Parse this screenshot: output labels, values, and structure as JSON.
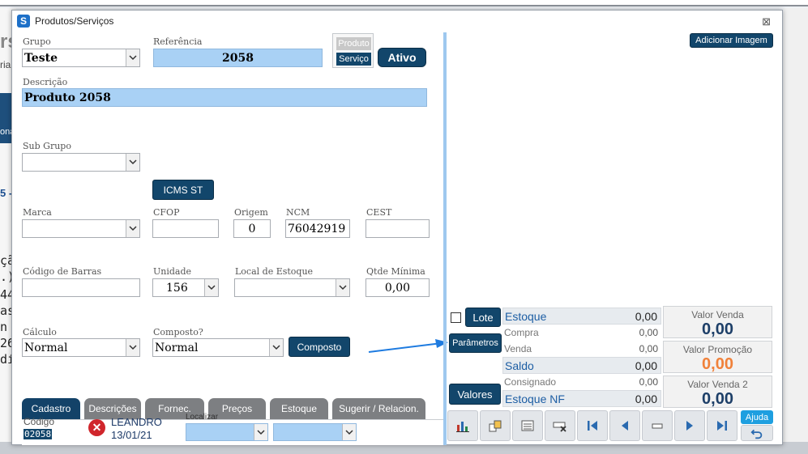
{
  "window": {
    "title": "Produtos/Serviços",
    "close_glyph": "⊠"
  },
  "background": {
    "code_lines": [
      "çã",
      ".)",
      "44",
      "as",
      "n t",
      "26",
      "dí"
    ],
    "side_texts": [
      "rs",
      "ria",
      "ona",
      "5 -"
    ]
  },
  "form": {
    "grupo": {
      "label": "Grupo",
      "value": "Teste"
    },
    "referencia": {
      "label": "Referência",
      "value": "2058"
    },
    "tipo": {
      "produto": "Produto",
      "servico": "Serviço"
    },
    "status_button": "Ativo",
    "descricao": {
      "label": "Descrição",
      "value": "Produto 2058"
    },
    "sub_grupo": {
      "label": "Sub Grupo",
      "value": ""
    },
    "icms_button": "ICMS ST",
    "marca": {
      "label": "Marca",
      "value": ""
    },
    "cfop": {
      "label": "CFOP",
      "value": ""
    },
    "origem": {
      "label": "Origem",
      "value": "0"
    },
    "ncm": {
      "label": "NCM",
      "value": "76042919"
    },
    "cest": {
      "label": "CEST",
      "value": ""
    },
    "codigo_barras": {
      "label": "Código de Barras",
      "value": ""
    },
    "unidade": {
      "label": "Unidade",
      "value": "156"
    },
    "local_estoque": {
      "label": "Local de Estoque",
      "value": ""
    },
    "qtde_minima": {
      "label": "Qtde Mínima",
      "value": "0,00"
    },
    "calculo": {
      "label": "Cálculo",
      "value": "Normal"
    },
    "composto": {
      "label": "Composto?",
      "value": "Normal"
    },
    "composto_button": "Composto"
  },
  "tabs": [
    "Cadastro",
    "Descrições",
    "Fornec.",
    "Preços",
    "Estoque",
    "Sugerir / Relacion."
  ],
  "footer": {
    "codigo_label": "Código",
    "codigo_value": "02058",
    "user": "LEANDRO",
    "date": "13/01/21",
    "localizar_label": "Localizar"
  },
  "right": {
    "add_image_button": "Adicionar Imagem",
    "lote_button": "Lote",
    "parametros_button": "Parâmetros",
    "valores_button": "Valores",
    "stats": [
      {
        "label": "Estoque",
        "value": "0,00"
      },
      {
        "label": "Compra",
        "value": "0,00"
      },
      {
        "label": "Venda",
        "value": "0,00"
      },
      {
        "label": "Saldo",
        "value": "0,00"
      },
      {
        "label": "Consignado",
        "value": "0,00"
      },
      {
        "label": "Estoque NF",
        "value": "0,00"
      }
    ],
    "valor_venda": {
      "label": "Valor Venda",
      "value": "0,00"
    },
    "valor_promocao": {
      "label": "Valor Promoção",
      "value": "0,00"
    },
    "valor_venda2": {
      "label": "Valor Venda 2",
      "value": "0,00"
    },
    "ajuda_label": "Ajuda"
  },
  "colors": {
    "accent_dark": "#12466b",
    "field_blue": "#a9d1f5",
    "promo_orange": "#f0813a",
    "arrow_blue": "#1e7be0"
  }
}
